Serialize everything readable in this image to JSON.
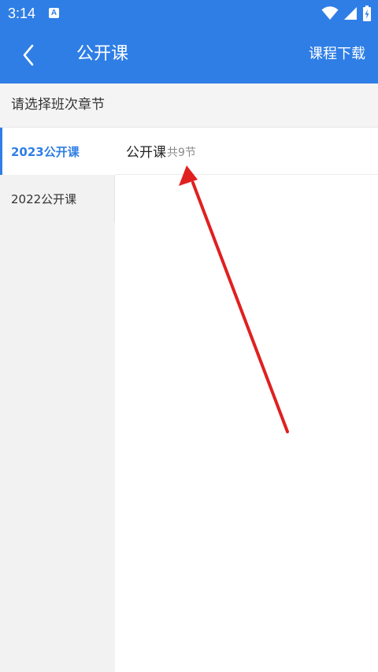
{
  "status_bar": {
    "time": "3:14",
    "app_icon_letter": "A",
    "icons": [
      "wifi-icon",
      "signal-icon",
      "battery-icon"
    ]
  },
  "app_bar": {
    "title": "公开课",
    "download_label": "课程下载",
    "back_icon": "chevron-left-icon"
  },
  "section_header": {
    "label": "请选择班次章节"
  },
  "sidebar": {
    "items": [
      {
        "label": "2023公开课",
        "selected": true
      },
      {
        "label": "2022公开课",
        "selected": false
      }
    ]
  },
  "lessons": [
    {
      "title": "公开课",
      "count_text": "共9节"
    }
  ],
  "colors": {
    "brand_blue": "#2f7ee6",
    "annotation_red": "#e02020"
  }
}
